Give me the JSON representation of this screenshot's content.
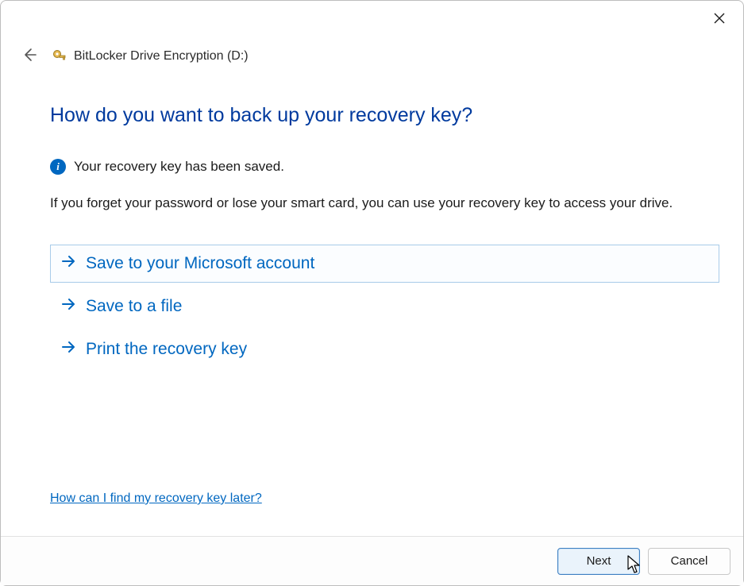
{
  "window": {
    "title": "BitLocker Drive Encryption (D:)"
  },
  "main": {
    "heading": "How do you want to back up your recovery key?",
    "info_text": "Your recovery key has been saved.",
    "explain_text": "If you forget your password or lose your smart card, you can use your recovery key to access your drive.",
    "options": [
      {
        "label": "Save to your Microsoft account",
        "selected": true
      },
      {
        "label": "Save to a file",
        "selected": false
      },
      {
        "label": "Print the recovery key",
        "selected": false
      }
    ],
    "help_link": "How can I find my recovery key later?"
  },
  "footer": {
    "next_label": "Next",
    "cancel_label": "Cancel"
  },
  "colors": {
    "accent": "#0067c0",
    "heading": "#003a9e"
  },
  "icons": {
    "close": "close-icon",
    "back": "back-arrow-icon",
    "app": "bitlocker-key-icon",
    "info": "info-icon",
    "arrow": "arrow-right-icon",
    "cursor": "cursor-icon"
  }
}
